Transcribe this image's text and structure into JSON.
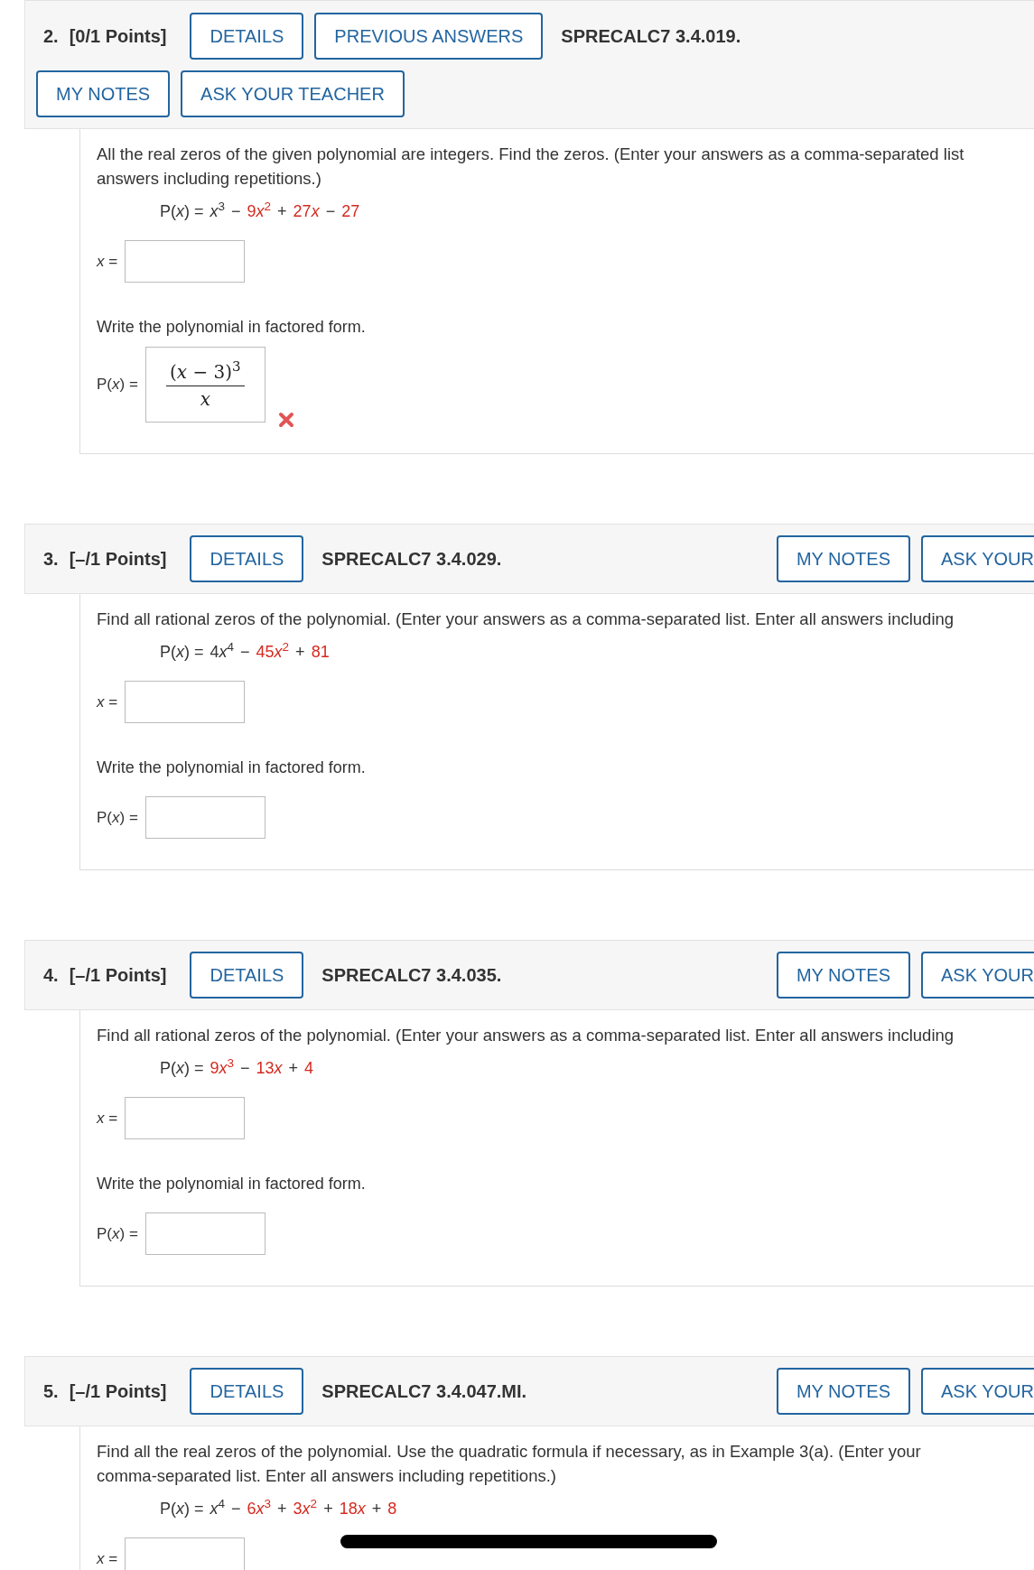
{
  "questions": [
    {
      "kind": "wrapped",
      "number": "2.",
      "points": "[0/1 Points]",
      "actions": [
        {
          "label": "DETAILS",
          "cut": false
        },
        {
          "label": "PREVIOUS ANSWERS",
          "cut": false
        }
      ],
      "code": "SPRECALC7 3.4.019.",
      "notes_actions": [
        {
          "label": "MY NOTES",
          "cut": false
        },
        {
          "label": "ASK YOUR TEACHER",
          "cut": false
        }
      ],
      "prompt_lines": [
        "All the real zeros of the given polynomial are integers. Find the zeros. (Enter your answers as a comma-separated list",
        "answers including repetitions.)"
      ],
      "polynomial": [
        {
          "text": "P(*x*) =",
          "highlighted": false
        },
        {
          "variable": "x",
          "power": "3",
          "highlighted": false
        },
        {
          "text": "−",
          "highlighted": false
        },
        {
          "text": "9",
          "variable": "x",
          "power": "2",
          "highlighted": true
        },
        {
          "text": "+",
          "highlighted": false
        },
        {
          "text": "27",
          "variable": "x",
          "highlighted": true
        },
        {
          "text": "−",
          "highlighted": false
        },
        {
          "text": "27",
          "highlighted": true
        }
      ],
      "parts": [
        {
          "kind": "blank",
          "label": "*x* ="
        },
        {
          "kind": "instruction",
          "text": "Write the polynomial in factored form."
        },
        {
          "kind": "fraction",
          "label": "P(*x*) =",
          "numerator": "(*x* − 3)$^{3}$",
          "denominator": "*x*",
          "correct": false
        }
      ]
    },
    {
      "kind": "single",
      "number": "3.",
      "points": "[–/1 Points]",
      "actions": [
        {
          "label": "DETAILS",
          "cut": false
        }
      ],
      "code": "SPRECALC7 3.4.029.",
      "notes_actions": [
        {
          "label": "MY NOTES",
          "cut": false
        },
        {
          "label": "ASK YOUR",
          "cut": true
        }
      ],
      "prompt_lines": [
        "Find all rational zeros of the polynomial. (Enter your answers as a comma-separated list. Enter all answers including"
      ],
      "polynomial": [
        {
          "text": "P(*x*) =",
          "highlighted": false
        },
        {
          "text": "4",
          "variable": "x",
          "power": "4",
          "highlighted": false
        },
        {
          "text": "−",
          "highlighted": false
        },
        {
          "text": "45",
          "variable": "x",
          "power": "2",
          "highlighted": true
        },
        {
          "text": "+",
          "highlighted": false
        },
        {
          "text": "81",
          "highlighted": true
        }
      ],
      "parts": [
        {
          "kind": "blank",
          "label": "*x* ="
        },
        {
          "kind": "instruction",
          "text": "Write the polynomial in factored form."
        },
        {
          "kind": "blank",
          "label": "P(*x*) ="
        }
      ]
    },
    {
      "kind": "single",
      "number": "4.",
      "points": "[–/1 Points]",
      "actions": [
        {
          "label": "DETAILS",
          "cut": false
        }
      ],
      "code": "SPRECALC7 3.4.035.",
      "notes_actions": [
        {
          "label": "MY NOTES",
          "cut": false
        },
        {
          "label": "ASK YOUR",
          "cut": true
        }
      ],
      "prompt_lines": [
        "Find all rational zeros of the polynomial. (Enter your answers as a comma-separated list. Enter all answers including"
      ],
      "polynomial": [
        {
          "text": "P(*x*) =",
          "highlighted": false
        },
        {
          "text": "9",
          "variable": "x",
          "power": "3",
          "highlighted": true
        },
        {
          "text": "−",
          "highlighted": false
        },
        {
          "text": "13",
          "variable": "x",
          "highlighted": true
        },
        {
          "text": "+",
          "highlighted": false
        },
        {
          "text": "4",
          "highlighted": true
        }
      ],
      "parts": [
        {
          "kind": "blank",
          "label": "*x* ="
        },
        {
          "kind": "instruction",
          "text": "Write the polynomial in factored form."
        },
        {
          "kind": "blank",
          "label": "P(*x*) ="
        }
      ]
    },
    {
      "kind": "single",
      "number": "5.",
      "points": "[–/1 Points]",
      "actions": [
        {
          "label": "DETAILS",
          "cut": false
        }
      ],
      "code": "SPRECALC7 3.4.047.MI.",
      "notes_actions": [
        {
          "label": "MY NOTES",
          "cut": false
        },
        {
          "label": "ASK YOUR",
          "cut": true
        }
      ],
      "prompt_lines": [
        "Find all the real zeros of the polynomial. Use the quadratic formula if necessary, as in Example 3(a). (Enter your",
        "comma-separated list. Enter all answers including repetitions.)"
      ],
      "polynomial": [
        {
          "text": "P(*x*) =",
          "highlighted": false
        },
        {
          "variable": "x",
          "power": "4",
          "highlighted": false
        },
        {
          "text": "−",
          "highlighted": false
        },
        {
          "text": "6",
          "variable": "x",
          "power": "3",
          "highlighted": true
        },
        {
          "text": "+",
          "highlighted": false
        },
        {
          "text": "3",
          "variable": "x",
          "power": "2",
          "highlighted": true
        },
        {
          "text": "+",
          "highlighted": false
        },
        {
          "text": "18",
          "variable": "x",
          "highlighted": true
        },
        {
          "text": "+",
          "highlighted": false
        },
        {
          "text": "8",
          "highlighted": true
        }
      ],
      "parts": [
        {
          "kind": "blank",
          "label": "*x* ="
        }
      ]
    }
  ]
}
